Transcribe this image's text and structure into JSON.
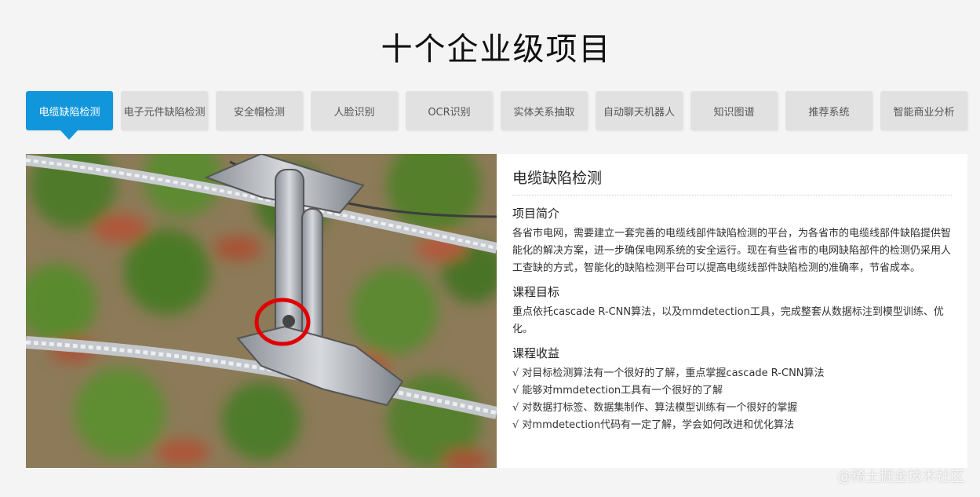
{
  "page_title": "十个企业级项目",
  "tabs": [
    {
      "label": "电缆缺陷检测",
      "active": true
    },
    {
      "label": "电子元件缺陷检测",
      "active": false
    },
    {
      "label": "安全帽检测",
      "active": false
    },
    {
      "label": "人脸识别",
      "active": false
    },
    {
      "label": "OCR识别",
      "active": false
    },
    {
      "label": "实体关系抽取",
      "active": false
    },
    {
      "label": "自动聊天机器人",
      "active": false
    },
    {
      "label": "知识图谱",
      "active": false
    },
    {
      "label": "推荐系统",
      "active": false
    },
    {
      "label": "智能商业分析",
      "active": false
    }
  ],
  "colors": {
    "accent": "#1296db",
    "tab_bg": "#e1e1e1",
    "defect_marker": "#e00000"
  },
  "detail": {
    "title": "电缆缺陷检测",
    "intro_heading": "项目简介",
    "intro_text": "各省市电网，需要建立一套完善的电缆线部件缺陷检测的平台，为各省市的电缆线部件缺陷提供智能化的解决方案，进一步确保电网系统的安全运行。现在有些省市的电网缺陷部件的检测仍采用人工查缺的方式，智能化的缺陷检测平台可以提高电缆线部件缺陷检测的准确率，节省成本。",
    "goal_heading": "课程目标",
    "goal_text": "重点依托cascade R-CNN算法，以及mmdetection工具，完成整套从数据标注到模型训练、优化。",
    "benefits_heading": "课程收益",
    "benefits": [
      "√ 对目标检测算法有一个很好的了解，重点掌握cascade R-CNN算法",
      "√ 能够对mmdetection工具有一个很好的了解",
      "√ 对数据打标签、数据集制作、算法模型训练有一个很好的掌握",
      "√ 对mmdetection代码有一定了解，学会如何改进和优化算法"
    ]
  },
  "photo": {
    "subject": "power-cable-clamp-photo",
    "marker_icon": "red-circle-defect-marker"
  },
  "watermark": "@稀土掘金技术社区"
}
